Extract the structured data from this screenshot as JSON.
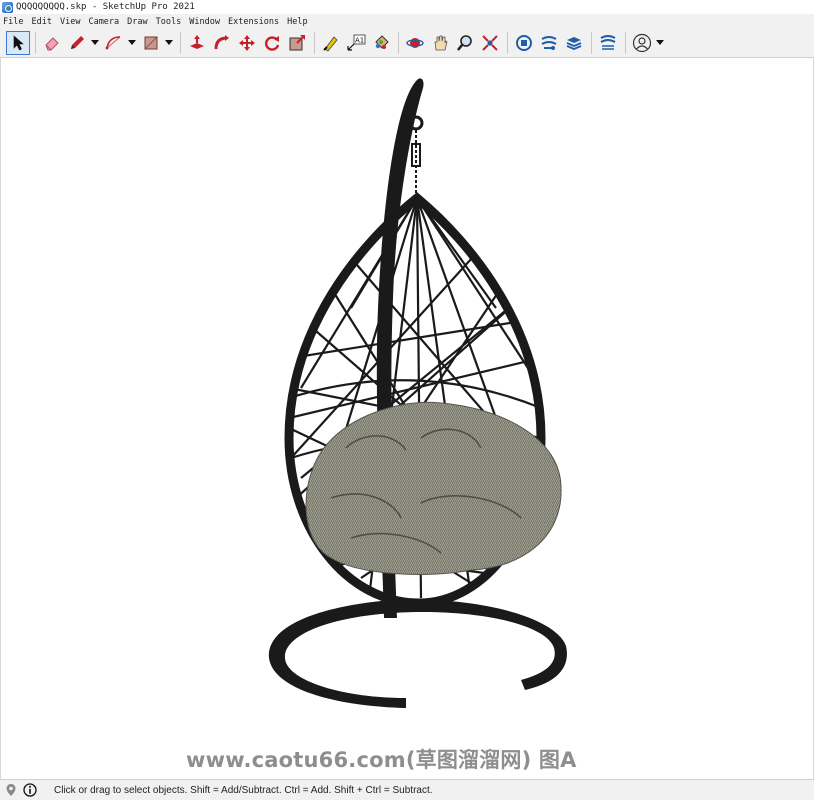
{
  "window": {
    "title": "QQQQQQQQQ.skp - SketchUp Pro 2021"
  },
  "menu": [
    "File",
    "Edit",
    "View",
    "Camera",
    "Draw",
    "Tools",
    "Window",
    "Extensions",
    "Help"
  ],
  "toolbar": {
    "tools": [
      "select-icon",
      "eraser-icon",
      "pencil-line-icon",
      "arc-icon",
      "rectangle-icon",
      "push-pull-icon",
      "follow-me-icon",
      "move-icon",
      "rotate-icon",
      "scale-icon",
      "tape-measure-icon",
      "text-icon",
      "paint-bucket-icon",
      "orbit-icon",
      "pan-icon",
      "zoom-icon",
      "zoom-extents-icon",
      "3d-warehouse-icon",
      "extension-warehouse-icon",
      "layout-icon",
      "extension-manager-icon",
      "account-icon"
    ],
    "text_tool_label": "A1"
  },
  "watermark": "www.caotu66.com(草图溜溜网) 图A",
  "status": {
    "text": "Click or drag to select objects. Shift = Add/Subtract. Ctrl = Add. Shift + Ctrl = Subtract."
  },
  "colors": {
    "accent": "#3b7bd3",
    "model_frame": "#1a1a1a",
    "cushion": "#6f6f63"
  }
}
